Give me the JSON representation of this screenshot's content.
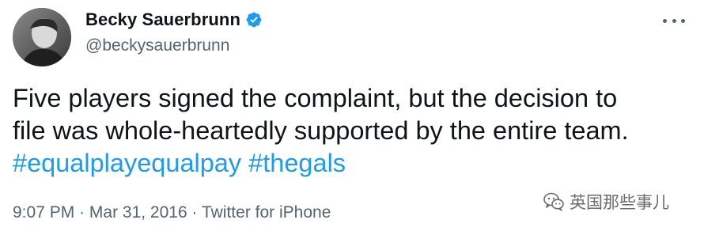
{
  "tweet": {
    "author": {
      "display_name": "Becky Sauerbrunn",
      "handle": "@beckysauerbrunn",
      "verified": true
    },
    "text_lines": [
      "Five players signed the complaint, but the decision to",
      "file was whole-heartedly supported by the entire team."
    ],
    "hashtags": [
      "#equalplayequalpay",
      "#thegals"
    ],
    "time": "9:07 PM",
    "date": "Mar 31, 2016",
    "source": "Twitter for iPhone",
    "separator": "·"
  },
  "watermark": {
    "text": "英国那些事儿"
  },
  "icons": {
    "verified": "verified-badge-icon",
    "more": "more-options-icon",
    "watermark": "wechat-logo-icon"
  },
  "colors": {
    "text": "#0f1419",
    "secondary": "#536471",
    "link": "#1d9bf0",
    "verified": "#1d9bf0"
  }
}
